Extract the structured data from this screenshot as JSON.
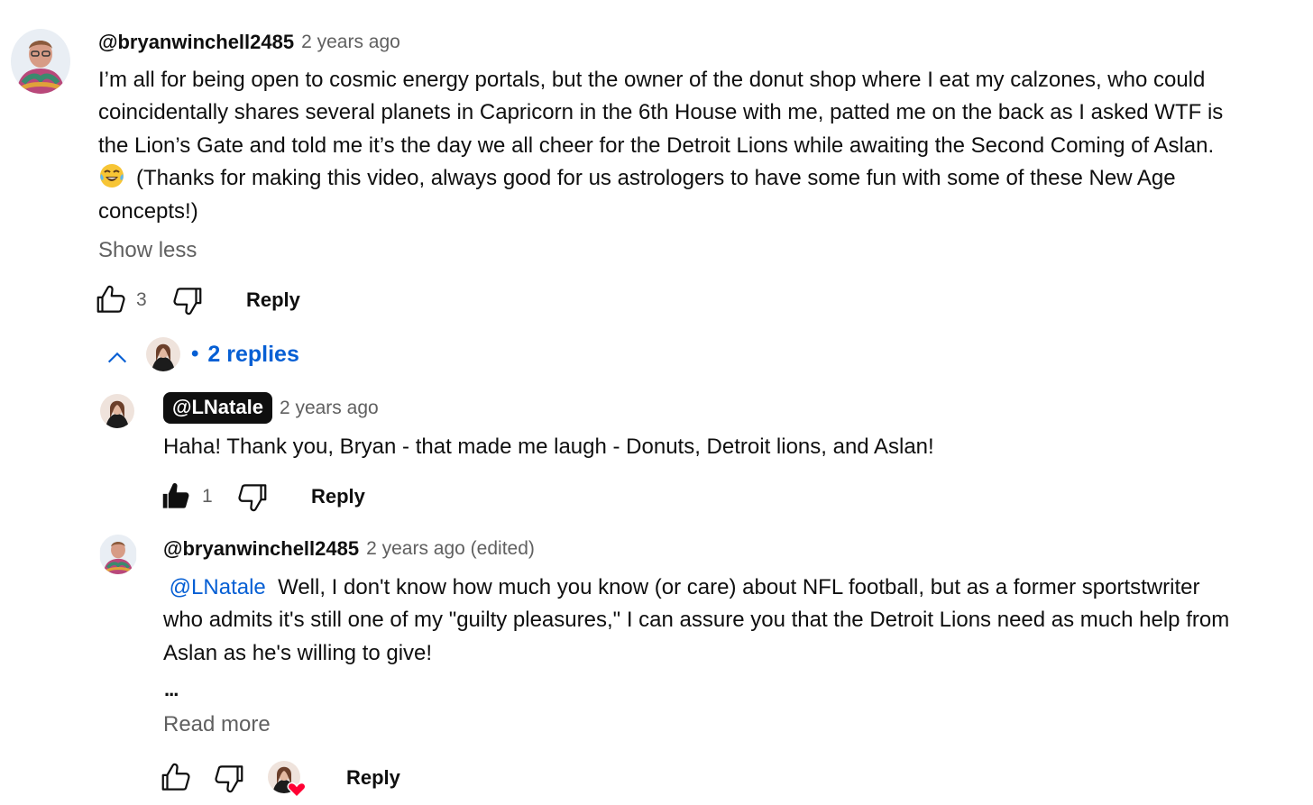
{
  "comment": {
    "author": "@bryanwinchell2485",
    "time": "2 years ago",
    "lines": [
      "I’m all for being open to cosmic energy portals, but the owner of the donut shop where I eat my calzones, who could",
      "coincidentally shares several planets in Capricorn in the 6th House with me, patted me on the back as I asked WTF is",
      "the Lion’s Gate and told me it’s the day we all cheer for the Detroit Lions while awaiting the Second Coming of Aslan.",
      "(Thanks for making this video, always good for us astrologers to have some fun with some of these New Age",
      "concepts!)"
    ],
    "emoji": "laughing-tears-emoji",
    "show_less": "Show less",
    "likes": "3",
    "reply_label": "Reply"
  },
  "replies_toggle": {
    "label": "2 replies",
    "icon": "chevron-up-icon"
  },
  "reply1": {
    "author": "@LNatale",
    "time": "2 years ago",
    "text": "Haha! Thank you, Bryan - that made me laugh - Donuts, Detroit lions, and Aslan!",
    "likes": "1",
    "reply_label": "Reply"
  },
  "reply2": {
    "author": "@bryanwinchell2485",
    "time": "2 years ago (edited)",
    "mention": "@LNatale",
    "line1_rest": "Well, I don't know how much you  know (or care) about NFL football, but as a former sportstwriter",
    "line2": "who admits it's still one of my \"guilty pleasures,\" I can assure you that the Detroit Lions need as much help from",
    "line3": "Aslan as he's willing to give!",
    "ellipsis": "...",
    "read_more": "Read more",
    "reply_label": "Reply"
  },
  "colors": {
    "text": "#0f0f0f",
    "secondary": "#606060",
    "link": "#065fd4",
    "heart": "#ff0033"
  }
}
